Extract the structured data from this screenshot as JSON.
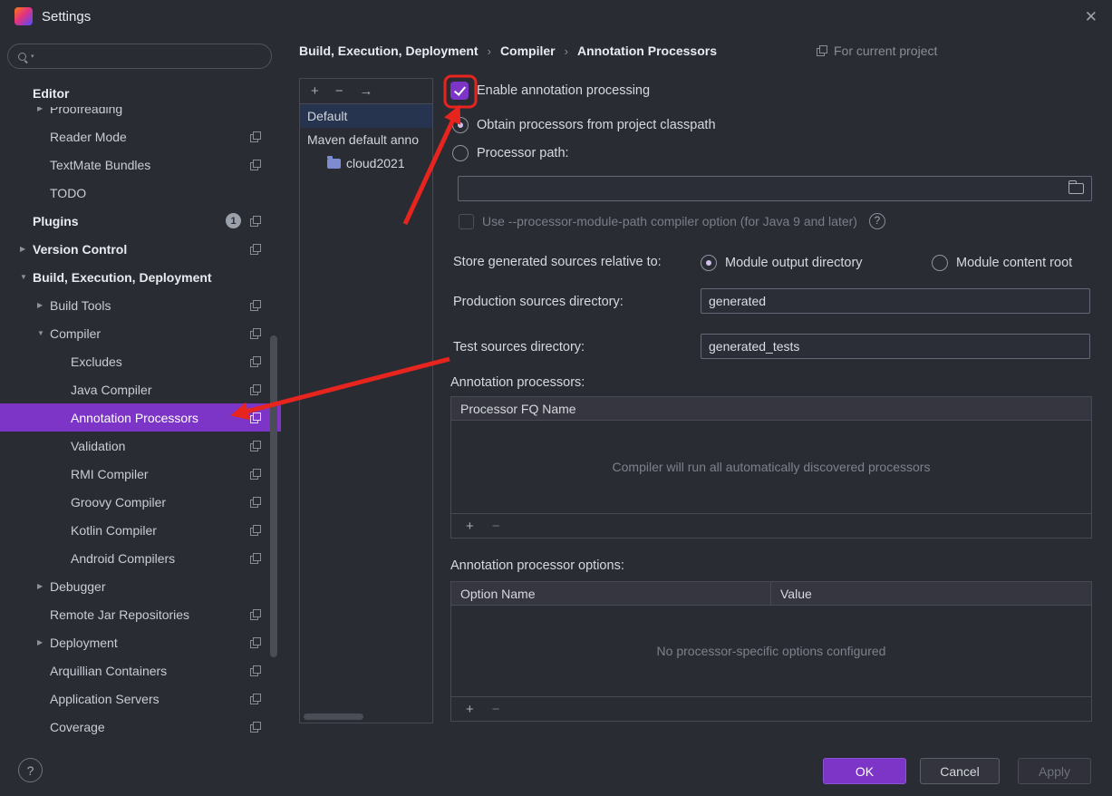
{
  "colors": {
    "accent": "#7C35C6",
    "arrow": "#E8241E",
    "list_selection": "#26344F"
  },
  "titlebar": {
    "title": "Settings",
    "close_icon": "✕"
  },
  "search": {
    "placeholder": ""
  },
  "sidebar": {
    "items": [
      {
        "label": "Editor",
        "level": 0,
        "bold": true
      },
      {
        "label": "Proofreading",
        "level": 1,
        "chevron": "right",
        "clipped": true
      },
      {
        "label": "Reader Mode",
        "level": 1,
        "copy": true
      },
      {
        "label": "TextMate Bundles",
        "level": 1,
        "copy": true
      },
      {
        "label": "TODO",
        "level": 1
      },
      {
        "label": "Plugins",
        "level": 0,
        "bold": true,
        "badge": "1",
        "copy": true
      },
      {
        "label": "Version Control",
        "level": 0,
        "bold": true,
        "chevron": "right",
        "copy": true
      },
      {
        "label": "Build, Execution, Deployment",
        "level": 0,
        "bold": true,
        "chevron": "down"
      },
      {
        "label": "Build Tools",
        "level": 1,
        "chevron": "right",
        "copy": true
      },
      {
        "label": "Compiler",
        "level": 1,
        "chevron": "down",
        "copy": true
      },
      {
        "label": "Excludes",
        "level": 2,
        "copy": true
      },
      {
        "label": "Java Compiler",
        "level": 2,
        "copy": true
      },
      {
        "label": "Annotation Processors",
        "level": 2,
        "selected": true,
        "copy": true
      },
      {
        "label": "Validation",
        "level": 2,
        "copy": true
      },
      {
        "label": "RMI Compiler",
        "level": 2,
        "copy": true
      },
      {
        "label": "Groovy Compiler",
        "level": 2,
        "copy": true
      },
      {
        "label": "Kotlin Compiler",
        "level": 2,
        "copy": true
      },
      {
        "label": "Android Compilers",
        "level": 2,
        "copy": true
      },
      {
        "label": "Debugger",
        "level": 1,
        "chevron": "right"
      },
      {
        "label": "Remote Jar Repositories",
        "level": 1,
        "copy": true
      },
      {
        "label": "Deployment",
        "level": 1,
        "chevron": "right",
        "copy": true
      },
      {
        "label": "Arquillian Containers",
        "level": 1,
        "copy": true
      },
      {
        "label": "Application Servers",
        "level": 1,
        "copy": true
      },
      {
        "label": "Coverage",
        "level": 1,
        "copy": true
      }
    ]
  },
  "profiles": {
    "add_icon": "+",
    "remove_icon": "−",
    "move_icon": "→",
    "items": [
      {
        "label": "Default",
        "selected": true
      },
      {
        "label": "Maven default anno"
      },
      {
        "label": "cloud2021",
        "module_icon": true
      }
    ]
  },
  "header": {
    "breadcrumb": [
      "Build, Execution, Deployment",
      "Compiler",
      "Annotation Processors"
    ],
    "separator": "›",
    "scope": "For current project"
  },
  "panel": {
    "enable_checkbox": "Enable annotation processing",
    "obtain_radio": "Obtain processors from project classpath",
    "processor_path_radio": "Processor path:",
    "processor_path_value": "",
    "module_path_checkbox": "Use --processor-module-path compiler option (for Java 9 and later)",
    "help_icon": "?",
    "store_label": "Store generated sources relative to:",
    "store_output": "Module output directory",
    "store_content": "Module content root",
    "production_label": "Production sources directory:",
    "production_value": "generated",
    "test_label": "Test sources directory:",
    "test_value": "generated_tests",
    "processors_label": "Annotation processors:",
    "processors_header": "Processor FQ Name",
    "processors_empty": "Compiler will run all automatically discovered processors",
    "options_label": "Annotation processor options:",
    "options_headers": [
      "Option Name",
      "Value"
    ],
    "options_empty": "No processor-specific options configured",
    "add_icon": "+",
    "remove_icon": "−"
  },
  "footer": {
    "help_icon": "?",
    "ok": "OK",
    "cancel": "Cancel",
    "apply": "Apply"
  }
}
